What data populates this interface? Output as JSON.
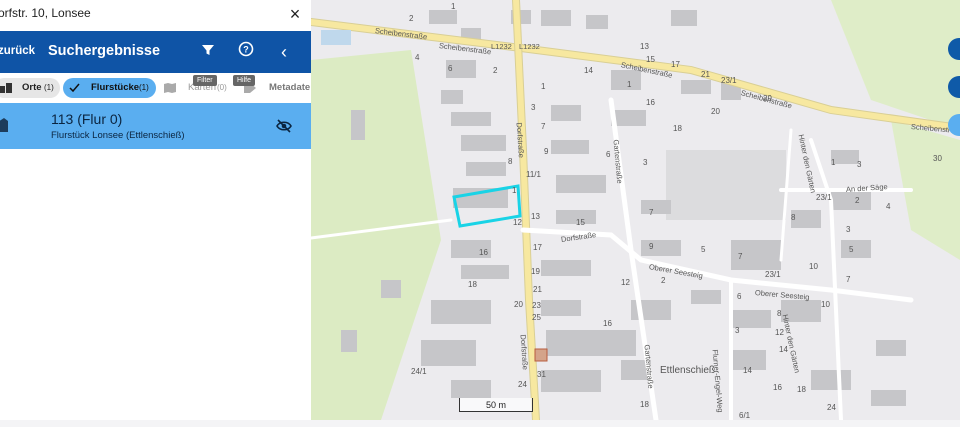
{
  "address_bar": {
    "text": "orfstr. 10, Lonsee",
    "close_glyph": "×"
  },
  "header": {
    "back_label": "zurück",
    "title": "Suchergebnisse",
    "filter_tooltip": "Filter",
    "help_tooltip": "Hilfe",
    "collapse_glyph": "‹"
  },
  "tabs": [
    {
      "label": "Orte",
      "count": "(1)"
    },
    {
      "label": "Flurstücke",
      "count": "(1)"
    },
    {
      "label": "Karten",
      "count": "(0)"
    },
    {
      "label": "Metadate",
      "count": ""
    }
  ],
  "result": {
    "title": "113 (Flur 0)",
    "subtitle": "Flurstück Lonsee (Ettlenschieß)"
  },
  "map": {
    "scale_label": "50 m",
    "place_name": "Ettlenschieß",
    "streets": {
      "scheibenstrasse": "Scheibenstraße",
      "l1232": "L1232",
      "dorfstrasse": "Dorfstraße",
      "gartenstrasse": "Gartenstraße",
      "oberer_seesteig": "Oberer Seesteig",
      "an_der_saege": "An der Säge",
      "hinter_den_gaerten": "Hinter den Gärten",
      "flurner_engel_weg": "Flurner-Engel-Weg"
    },
    "house_numbers": [
      "1",
      "2",
      "3",
      "4",
      "5",
      "6",
      "7",
      "8",
      "9",
      "10",
      "11",
      "12",
      "13",
      "14",
      "15",
      "16",
      "17",
      "18",
      "19",
      "20",
      "21",
      "23",
      "24",
      "25",
      "29",
      "30",
      "31",
      "11/1",
      "23/1",
      "6/1",
      "7/1",
      "24/1"
    ],
    "colors": {
      "highlight": "#19d3e6",
      "road": "#f7e8a0",
      "building": "#c9c9cb",
      "green": "#dfecc5"
    }
  }
}
